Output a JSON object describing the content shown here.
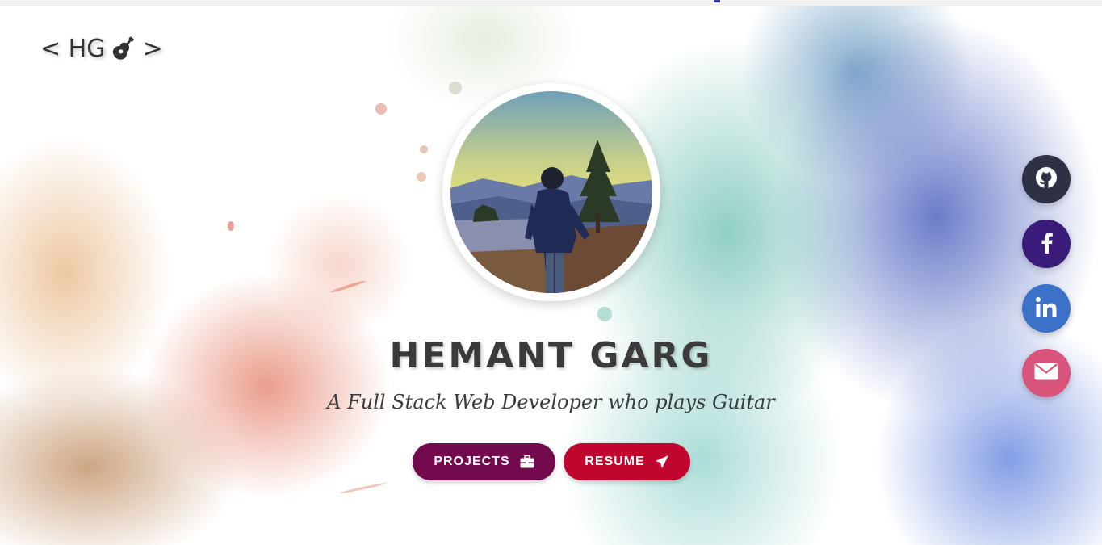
{
  "logo": {
    "left_bracket": "< HG",
    "right_bracket": ">",
    "icon": "guitar-icon"
  },
  "hero": {
    "name": "HEMANT GARG",
    "tagline": "A Full Stack Web Developer who plays Guitar",
    "avatar_icon": "profile-photo"
  },
  "buttons": {
    "projects": {
      "label": "PROJECTS",
      "icon": "briefcase-icon"
    },
    "resume": {
      "label": "RESUME",
      "icon": "paper-plane-icon"
    }
  },
  "social": [
    {
      "name": "GitHub",
      "icon": "github-icon",
      "color": "#2e3144"
    },
    {
      "name": "Facebook",
      "icon": "facebook-icon",
      "color": "#3a1b7a"
    },
    {
      "name": "LinkedIn",
      "icon": "linkedin-icon",
      "color": "#3b72c7"
    },
    {
      "name": "Email",
      "icon": "envelope-icon",
      "color": "#d9547a"
    }
  ],
  "colors": {
    "projects_button": "#730a4d",
    "resume_button": "#c0062f",
    "text": "#3b3b3b"
  }
}
